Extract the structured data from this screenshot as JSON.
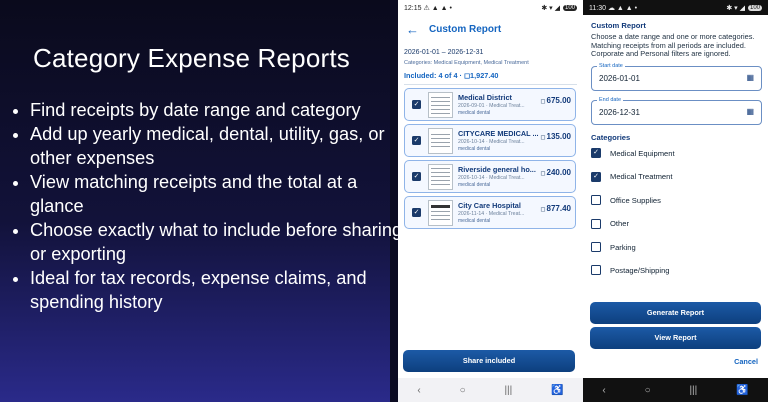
{
  "promo": {
    "title": "Category Expense Reports",
    "bullets": [
      "Find receipts by date range and category",
      "Add up yearly medical, dental, utility, gas, or other expenses",
      "View matching receipts and the total at a glance",
      "Choose exactly what to include before sharing or exporting",
      "Ideal for tax records, expense claims, and spending history"
    ]
  },
  "screen1": {
    "status": {
      "time": "12:15",
      "icons": "⚠ ▲ ▲ •",
      "signal": "✱ ▾ ◢",
      "battery": "100"
    },
    "title": "Custom Report",
    "date_range": "2026-01-01 – 2026-12-31",
    "categories": "Categories: Medical Equipment, Medical Treatment",
    "included": "Included: 4 of 4 · ◻1,927.40",
    "receipts": [
      {
        "merchant": "Medical District",
        "sub": "2026-09-01 · Medical Treat...",
        "tag": "medical dental",
        "amount": "675.00"
      },
      {
        "merchant": "CITYCARE MEDICAL ...",
        "sub": "2026-10-14 · Medical Treat...",
        "tag": "medical dental",
        "amount": "135.00"
      },
      {
        "merchant": "Riverside general ho...",
        "sub": "2026-10-14 · Medical Treat...",
        "tag": "medical dental",
        "amount": "240.00"
      },
      {
        "merchant": "City Care Hospital",
        "sub": "2026-11-14 · Medical Treat...",
        "tag": "medical dental",
        "amount": "877.40"
      }
    ],
    "share_label": "Share included"
  },
  "screen2": {
    "status": {
      "time": "11:30",
      "icons": "☁ ▲ ▲ •",
      "signal": "✱ ▾ ◢",
      "battery": "100"
    },
    "heading": "Custom Report",
    "description": "Choose a date range and one or more categories. Matching receipts from all periods are included. Corporate and Personal filters are ignored.",
    "start_label": "Start date",
    "start_value": "2026-01-01",
    "end_label": "End date",
    "end_value": "2026-12-31",
    "categories_heading": "Categories",
    "categories": [
      {
        "label": "Medical Equipment",
        "checked": true
      },
      {
        "label": "Medical Treatment",
        "checked": true
      },
      {
        "label": "Office Supplies",
        "checked": false
      },
      {
        "label": "Other",
        "checked": false
      },
      {
        "label": "Parking",
        "checked": false
      },
      {
        "label": "Postage/Shipping",
        "checked": false
      }
    ],
    "generate_label": "Generate Report",
    "view_label": "View Report",
    "cancel_label": "Cancel"
  },
  "nav": {
    "back": "‹",
    "home": "○",
    "recents": "|||",
    "accessibility": "♿"
  },
  "colors": {
    "accent": "#1565c0",
    "button": "#0d3f7e",
    "promo_bg": "#0a0a1c"
  }
}
